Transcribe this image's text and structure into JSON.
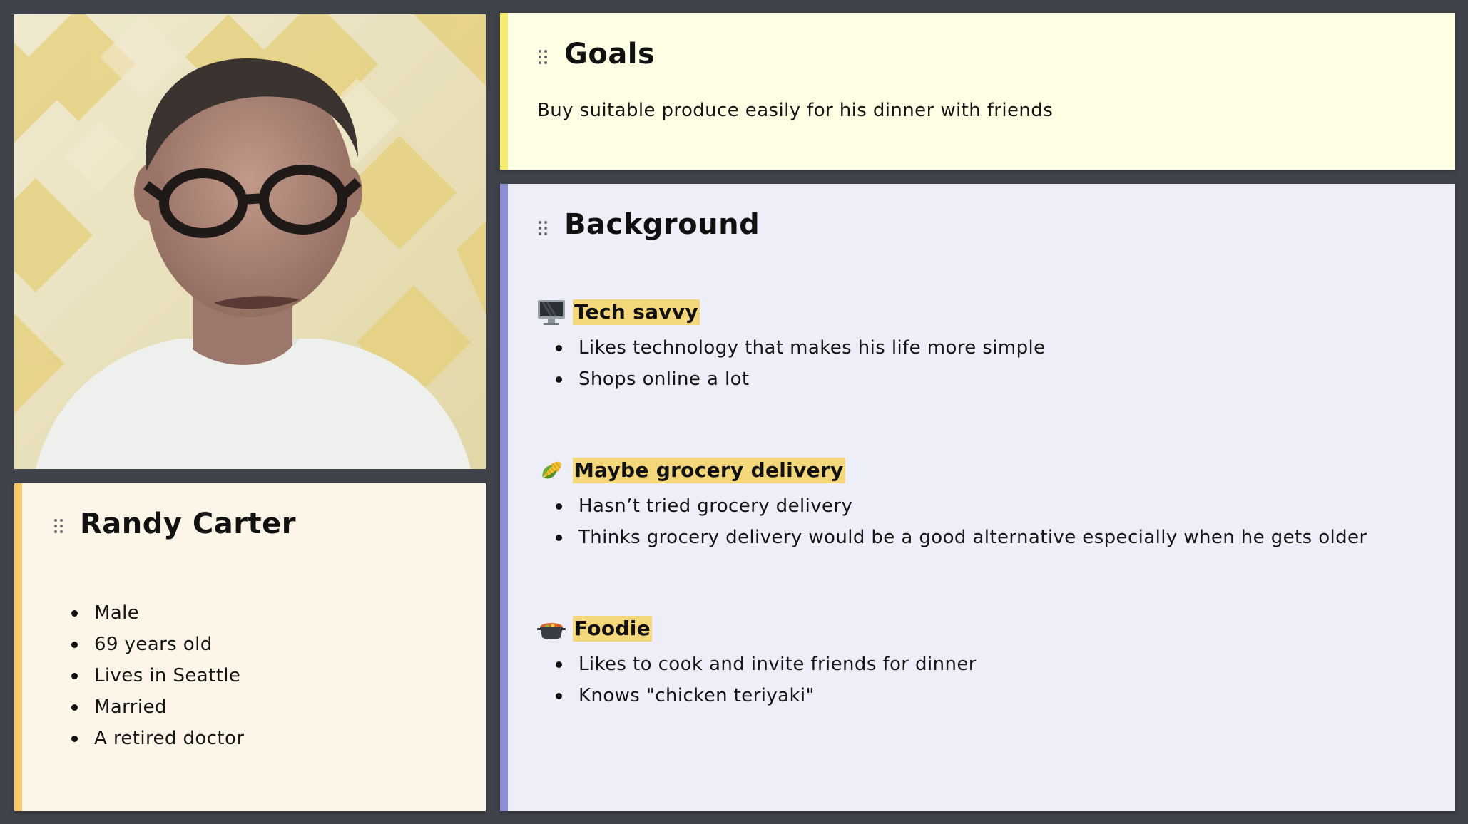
{
  "profile": {
    "name": "Randy Carter",
    "facts": [
      "Male",
      "69 years old",
      "Lives in Seattle",
      "Married",
      "A retired doctor"
    ]
  },
  "goals": {
    "title": "Goals",
    "text": "Buy suitable produce easily for his dinner with friends"
  },
  "background": {
    "title": "Background",
    "sections": [
      {
        "icon": "desktop-computer-icon",
        "title": "Tech savvy",
        "items": [
          "Likes technology that makes his life more simple",
          "Shops online a lot"
        ]
      },
      {
        "icon": "corn-icon",
        "title": "Maybe grocery delivery",
        "items": [
          "Hasn’t tried grocery delivery",
          "Thinks grocery delivery would be a good alternative especially when he gets older"
        ]
      },
      {
        "icon": "pot-of-food-icon",
        "title": "Foodie",
        "items": [
          "Likes to cook and invite friends for dinner",
          "Knows \"chicken teriyaki\""
        ]
      }
    ]
  },
  "colors": {
    "board": "#3f4249",
    "profile_card": "#fdf6e8",
    "profile_accent": "#f6c768",
    "goals_card": "#fefee4",
    "goals_accent": "#f5ea6a",
    "background_card": "#eeeef8",
    "background_accent": "#8a8fd4",
    "highlight": "#f3d77a"
  }
}
